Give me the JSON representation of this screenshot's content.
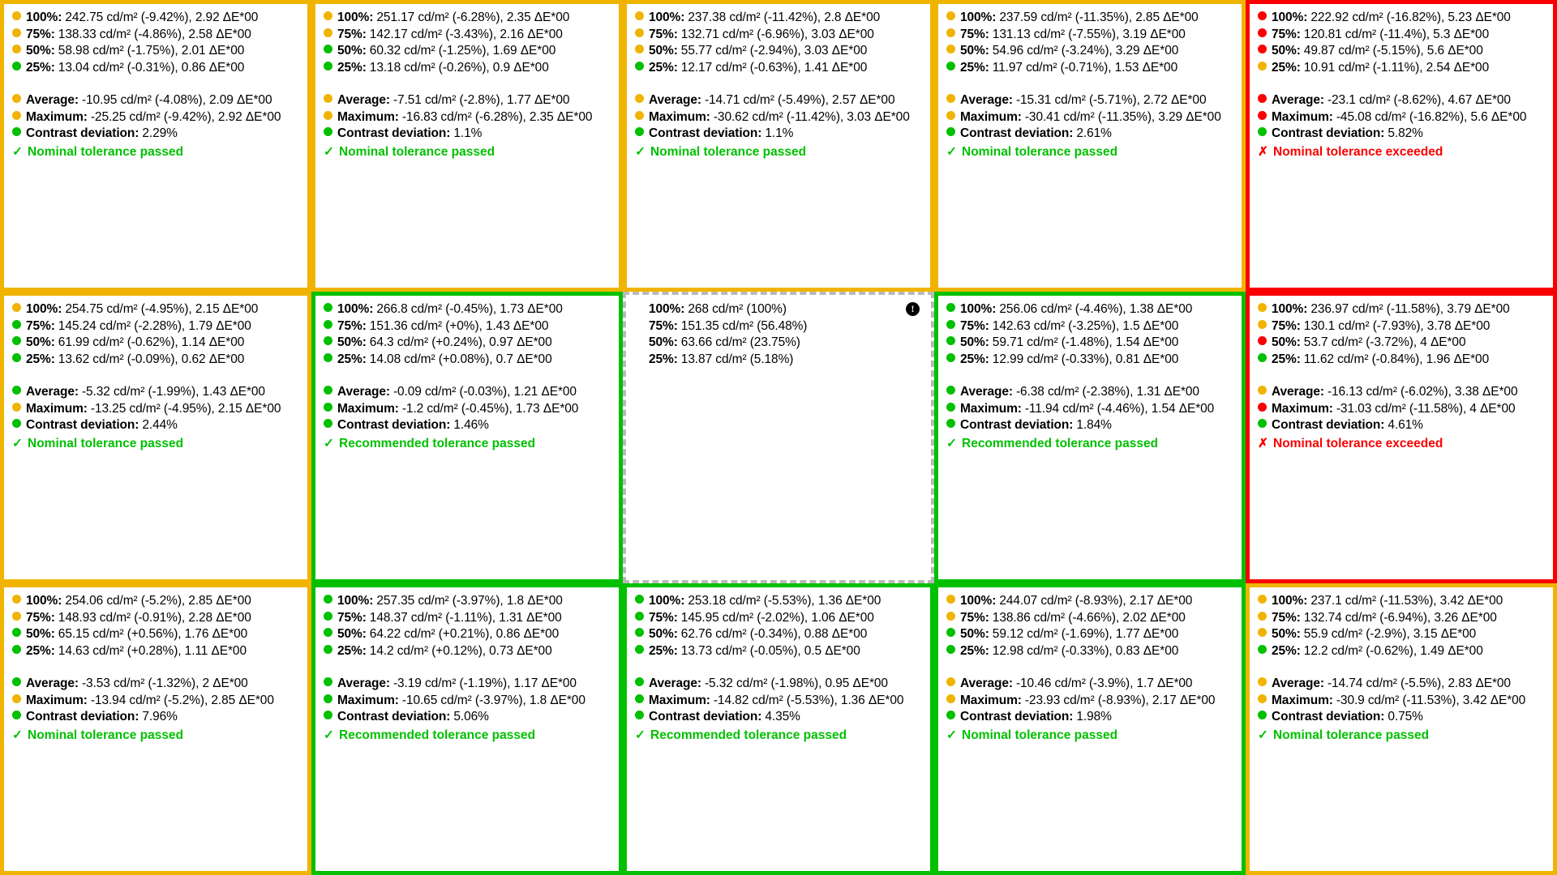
{
  "theme": {
    "amber": "#f0b400",
    "green": "#00c000",
    "red": "#fa0000",
    "reference_border": "#b9b9b9",
    "text": "#000000",
    "background": "#ffffff"
  },
  "icons": {
    "info": "!",
    "pass_mark": "✓",
    "fail_mark": "✗"
  },
  "labels": {
    "l100": "100%:",
    "l75": "75%:",
    "l50": "50%:",
    "l25": "25%:",
    "average": "Average:",
    "maximum": "Maximum:",
    "contrast": "Contrast deviation:"
  },
  "cells": [
    {
      "id": "cell-r1c1",
      "status": "amber",
      "reference": false,
      "rows": [
        {
          "dot": "amber",
          "label": "100%:",
          "value": "242.75 cd/m² (-9.42%), 2.92 ΔE*00"
        },
        {
          "dot": "amber",
          "label": "75%:",
          "value": "138.33 cd/m² (-4.86%), 2.58 ΔE*00"
        },
        {
          "dot": "amber",
          "label": "50%:",
          "value": "58.98 cd/m² (-1.75%), 2.01 ΔE*00"
        },
        {
          "dot": "green",
          "label": "25%:",
          "value": "13.04 cd/m² (-0.31%), 0.86 ΔE*00"
        }
      ],
      "summary": [
        {
          "dot": "amber",
          "label": "Average:",
          "value": "-10.95 cd/m² (-4.08%), 2.09 ΔE*00"
        },
        {
          "dot": "amber",
          "label": "Maximum:",
          "value": "-25.25 cd/m² (-9.42%), 2.92 ΔE*00"
        },
        {
          "dot": "green",
          "label": "Contrast deviation:",
          "value": "2.29%"
        }
      ],
      "verdict": {
        "result": "pass",
        "mark": "✓",
        "text": "Nominal tolerance passed"
      }
    },
    {
      "id": "cell-r1c2",
      "status": "amber",
      "reference": false,
      "rows": [
        {
          "dot": "amber",
          "label": "100%:",
          "value": "251.17 cd/m² (-6.28%), 2.35 ΔE*00"
        },
        {
          "dot": "amber",
          "label": "75%:",
          "value": "142.17 cd/m² (-3.43%), 2.16 ΔE*00"
        },
        {
          "dot": "green",
          "label": "50%:",
          "value": "60.32 cd/m² (-1.25%), 1.69 ΔE*00"
        },
        {
          "dot": "green",
          "label": "25%:",
          "value": "13.18 cd/m² (-0.26%), 0.9 ΔE*00"
        }
      ],
      "summary": [
        {
          "dot": "amber",
          "label": "Average:",
          "value": "-7.51 cd/m² (-2.8%), 1.77 ΔE*00"
        },
        {
          "dot": "amber",
          "label": "Maximum:",
          "value": "-16.83 cd/m² (-6.28%), 2.35 ΔE*00"
        },
        {
          "dot": "green",
          "label": "Contrast deviation:",
          "value": "1.1%"
        }
      ],
      "verdict": {
        "result": "pass",
        "mark": "✓",
        "text": "Nominal tolerance passed"
      }
    },
    {
      "id": "cell-r1c3",
      "status": "amber",
      "reference": false,
      "rows": [
        {
          "dot": "amber",
          "label": "100%:",
          "value": "237.38 cd/m² (-11.42%), 2.8 ΔE*00"
        },
        {
          "dot": "amber",
          "label": "75%:",
          "value": "132.71 cd/m² (-6.96%), 3.03 ΔE*00"
        },
        {
          "dot": "amber",
          "label": "50%:",
          "value": "55.77 cd/m² (-2.94%), 3.03 ΔE*00"
        },
        {
          "dot": "green",
          "label": "25%:",
          "value": "12.17 cd/m² (-0.63%), 1.41 ΔE*00"
        }
      ],
      "summary": [
        {
          "dot": "amber",
          "label": "Average:",
          "value": "-14.71 cd/m² (-5.49%), 2.57 ΔE*00"
        },
        {
          "dot": "amber",
          "label": "Maximum:",
          "value": "-30.62 cd/m² (-11.42%), 3.03 ΔE*00"
        },
        {
          "dot": "green",
          "label": "Contrast deviation:",
          "value": "1.1%"
        }
      ],
      "verdict": {
        "result": "pass",
        "mark": "✓",
        "text": "Nominal tolerance passed"
      }
    },
    {
      "id": "cell-r1c4",
      "status": "amber",
      "reference": false,
      "rows": [
        {
          "dot": "amber",
          "label": "100%:",
          "value": "237.59 cd/m² (-11.35%), 2.85 ΔE*00"
        },
        {
          "dot": "amber",
          "label": "75%:",
          "value": "131.13 cd/m² (-7.55%), 3.19 ΔE*00"
        },
        {
          "dot": "amber",
          "label": "50%:",
          "value": "54.96 cd/m² (-3.24%), 3.29 ΔE*00"
        },
        {
          "dot": "green",
          "label": "25%:",
          "value": "11.97 cd/m² (-0.71%), 1.53 ΔE*00"
        }
      ],
      "summary": [
        {
          "dot": "amber",
          "label": "Average:",
          "value": "-15.31 cd/m² (-5.71%), 2.72 ΔE*00"
        },
        {
          "dot": "amber",
          "label": "Maximum:",
          "value": "-30.41 cd/m² (-11.35%), 3.29 ΔE*00"
        },
        {
          "dot": "green",
          "label": "Contrast deviation:",
          "value": "2.61%"
        }
      ],
      "verdict": {
        "result": "pass",
        "mark": "✓",
        "text": "Nominal tolerance passed"
      }
    },
    {
      "id": "cell-r1c5",
      "status": "red",
      "reference": false,
      "rows": [
        {
          "dot": "red",
          "label": "100%:",
          "value": "222.92 cd/m² (-16.82%), 5.23 ΔE*00"
        },
        {
          "dot": "red",
          "label": "75%:",
          "value": "120.81 cd/m² (-11.4%), 5.3 ΔE*00"
        },
        {
          "dot": "red",
          "label": "50%:",
          "value": "49.87 cd/m² (-5.15%), 5.6 ΔE*00"
        },
        {
          "dot": "amber",
          "label": "25%:",
          "value": "10.91 cd/m² (-1.11%), 2.54 ΔE*00"
        }
      ],
      "summary": [
        {
          "dot": "red",
          "label": "Average:",
          "value": "-23.1 cd/m² (-8.62%), 4.67 ΔE*00"
        },
        {
          "dot": "red",
          "label": "Maximum:",
          "value": "-45.08 cd/m² (-16.82%), 5.6 ΔE*00"
        },
        {
          "dot": "green",
          "label": "Contrast deviation:",
          "value": "5.82%"
        }
      ],
      "verdict": {
        "result": "fail",
        "mark": "✗",
        "text": "Nominal tolerance exceeded"
      }
    },
    {
      "id": "cell-r2c1",
      "status": "amber",
      "reference": false,
      "rows": [
        {
          "dot": "amber",
          "label": "100%:",
          "value": "254.75 cd/m² (-4.95%), 2.15 ΔE*00"
        },
        {
          "dot": "green",
          "label": "75%:",
          "value": "145.24 cd/m² (-2.28%), 1.79 ΔE*00"
        },
        {
          "dot": "green",
          "label": "50%:",
          "value": "61.99 cd/m² (-0.62%), 1.14 ΔE*00"
        },
        {
          "dot": "green",
          "label": "25%:",
          "value": "13.62 cd/m² (-0.09%), 0.62 ΔE*00"
        }
      ],
      "summary": [
        {
          "dot": "green",
          "label": "Average:",
          "value": "-5.32 cd/m² (-1.99%), 1.43 ΔE*00"
        },
        {
          "dot": "amber",
          "label": "Maximum:",
          "value": "-13.25 cd/m² (-4.95%), 2.15 ΔE*00"
        },
        {
          "dot": "green",
          "label": "Contrast deviation:",
          "value": "2.44%"
        }
      ],
      "verdict": {
        "result": "pass",
        "mark": "✓",
        "text": "Nominal tolerance passed"
      }
    },
    {
      "id": "cell-r2c2",
      "status": "green",
      "reference": false,
      "rows": [
        {
          "dot": "green",
          "label": "100%:",
          "value": "266.8 cd/m² (-0.45%), 1.73 ΔE*00"
        },
        {
          "dot": "green",
          "label": "75%:",
          "value": "151.36 cd/m² (+0%), 1.43 ΔE*00"
        },
        {
          "dot": "green",
          "label": "50%:",
          "value": "64.3 cd/m² (+0.24%), 0.97 ΔE*00"
        },
        {
          "dot": "green",
          "label": "25%:",
          "value": "14.08 cd/m² (+0.08%), 0.7 ΔE*00"
        }
      ],
      "summary": [
        {
          "dot": "green",
          "label": "Average:",
          "value": "-0.09 cd/m² (-0.03%), 1.21 ΔE*00"
        },
        {
          "dot": "green",
          "label": "Maximum:",
          "value": "-1.2 cd/m² (-0.45%), 1.73 ΔE*00"
        },
        {
          "dot": "green",
          "label": "Contrast deviation:",
          "value": "1.46%"
        }
      ],
      "verdict": {
        "result": "pass",
        "mark": "✓",
        "text": "Recommended tolerance passed"
      }
    },
    {
      "id": "cell-r2c3",
      "status": "ref",
      "reference": true,
      "info_icon": "!",
      "rows": [
        {
          "dot": "none",
          "label": "100%:",
          "value": "268 cd/m² (100%)"
        },
        {
          "dot": "none",
          "label": "75%:",
          "value": "151.35 cd/m² (56.48%)"
        },
        {
          "dot": "none",
          "label": "50%:",
          "value": "63.66 cd/m² (23.75%)"
        },
        {
          "dot": "none",
          "label": "25%:",
          "value": "13.87 cd/m² (5.18%)"
        }
      ],
      "summary": [],
      "verdict": null
    },
    {
      "id": "cell-r2c4",
      "status": "green",
      "reference": false,
      "rows": [
        {
          "dot": "green",
          "label": "100%:",
          "value": "256.06 cd/m² (-4.46%), 1.38 ΔE*00"
        },
        {
          "dot": "green",
          "label": "75%:",
          "value": "142.63 cd/m² (-3.25%), 1.5 ΔE*00"
        },
        {
          "dot": "green",
          "label": "50%:",
          "value": "59.71 cd/m² (-1.48%), 1.54 ΔE*00"
        },
        {
          "dot": "green",
          "label": "25%:",
          "value": "12.99 cd/m² (-0.33%), 0.81 ΔE*00"
        }
      ],
      "summary": [
        {
          "dot": "green",
          "label": "Average:",
          "value": "-6.38 cd/m² (-2.38%), 1.31 ΔE*00"
        },
        {
          "dot": "green",
          "label": "Maximum:",
          "value": "-11.94 cd/m² (-4.46%), 1.54 ΔE*00"
        },
        {
          "dot": "green",
          "label": "Contrast deviation:",
          "value": "1.84%"
        }
      ],
      "verdict": {
        "result": "pass",
        "mark": "✓",
        "text": "Recommended tolerance passed"
      }
    },
    {
      "id": "cell-r2c5",
      "status": "red",
      "reference": false,
      "rows": [
        {
          "dot": "amber",
          "label": "100%:",
          "value": "236.97 cd/m² (-11.58%), 3.79 ΔE*00"
        },
        {
          "dot": "amber",
          "label": "75%:",
          "value": "130.1 cd/m² (-7.93%), 3.78 ΔE*00"
        },
        {
          "dot": "red",
          "label": "50%:",
          "value": "53.7 cd/m² (-3.72%), 4 ΔE*00"
        },
        {
          "dot": "green",
          "label": "25%:",
          "value": "11.62 cd/m² (-0.84%), 1.96 ΔE*00"
        }
      ],
      "summary": [
        {
          "dot": "amber",
          "label": "Average:",
          "value": "-16.13 cd/m² (-6.02%), 3.38 ΔE*00"
        },
        {
          "dot": "red",
          "label": "Maximum:",
          "value": "-31.03 cd/m² (-11.58%), 4 ΔE*00"
        },
        {
          "dot": "green",
          "label": "Contrast deviation:",
          "value": "4.61%"
        }
      ],
      "verdict": {
        "result": "fail",
        "mark": "✗",
        "text": "Nominal tolerance exceeded"
      }
    },
    {
      "id": "cell-r3c1",
      "status": "amber",
      "reference": false,
      "rows": [
        {
          "dot": "amber",
          "label": "100%:",
          "value": "254.06 cd/m² (-5.2%), 2.85 ΔE*00"
        },
        {
          "dot": "amber",
          "label": "75%:",
          "value": "148.93 cd/m² (-0.91%), 2.28 ΔE*00"
        },
        {
          "dot": "green",
          "label": "50%:",
          "value": "65.15 cd/m² (+0.56%), 1.76 ΔE*00"
        },
        {
          "dot": "green",
          "label": "25%:",
          "value": "14.63 cd/m² (+0.28%), 1.11 ΔE*00"
        }
      ],
      "summary": [
        {
          "dot": "green",
          "label": "Average:",
          "value": "-3.53 cd/m² (-1.32%), 2 ΔE*00"
        },
        {
          "dot": "amber",
          "label": "Maximum:",
          "value": "-13.94 cd/m² (-5.2%), 2.85 ΔE*00"
        },
        {
          "dot": "green",
          "label": "Contrast deviation:",
          "value": "7.96%"
        }
      ],
      "verdict": {
        "result": "pass",
        "mark": "✓",
        "text": "Nominal tolerance passed"
      }
    },
    {
      "id": "cell-r3c2",
      "status": "green",
      "reference": false,
      "rows": [
        {
          "dot": "green",
          "label": "100%:",
          "value": "257.35 cd/m² (-3.97%), 1.8 ΔE*00"
        },
        {
          "dot": "green",
          "label": "75%:",
          "value": "148.37 cd/m² (-1.11%), 1.31 ΔE*00"
        },
        {
          "dot": "green",
          "label": "50%:",
          "value": "64.22 cd/m² (+0.21%), 0.86 ΔE*00"
        },
        {
          "dot": "green",
          "label": "25%:",
          "value": "14.2 cd/m² (+0.12%), 0.73 ΔE*00"
        }
      ],
      "summary": [
        {
          "dot": "green",
          "label": "Average:",
          "value": "-3.19 cd/m² (-1.19%), 1.17 ΔE*00"
        },
        {
          "dot": "green",
          "label": "Maximum:",
          "value": "-10.65 cd/m² (-3.97%), 1.8 ΔE*00"
        },
        {
          "dot": "green",
          "label": "Contrast deviation:",
          "value": "5.06%"
        }
      ],
      "verdict": {
        "result": "pass",
        "mark": "✓",
        "text": "Recommended tolerance passed"
      }
    },
    {
      "id": "cell-r3c3",
      "status": "green",
      "reference": false,
      "rows": [
        {
          "dot": "green",
          "label": "100%:",
          "value": "253.18 cd/m² (-5.53%), 1.36 ΔE*00"
        },
        {
          "dot": "green",
          "label": "75%:",
          "value": "145.95 cd/m² (-2.02%), 1.06 ΔE*00"
        },
        {
          "dot": "green",
          "label": "50%:",
          "value": "62.76 cd/m² (-0.34%), 0.88 ΔE*00"
        },
        {
          "dot": "green",
          "label": "25%:",
          "value": "13.73 cd/m² (-0.05%), 0.5 ΔE*00"
        }
      ],
      "summary": [
        {
          "dot": "green",
          "label": "Average:",
          "value": "-5.32 cd/m² (-1.98%), 0.95 ΔE*00"
        },
        {
          "dot": "green",
          "label": "Maximum:",
          "value": "-14.82 cd/m² (-5.53%), 1.36 ΔE*00"
        },
        {
          "dot": "green",
          "label": "Contrast deviation:",
          "value": "4.35%"
        }
      ],
      "verdict": {
        "result": "pass",
        "mark": "✓",
        "text": "Recommended tolerance passed"
      }
    },
    {
      "id": "cell-r3c4",
      "status": "green",
      "reference": false,
      "rows": [
        {
          "dot": "amber",
          "label": "100%:",
          "value": "244.07 cd/m² (-8.93%), 2.17 ΔE*00"
        },
        {
          "dot": "amber",
          "label": "75%:",
          "value": "138.86 cd/m² (-4.66%), 2.02 ΔE*00"
        },
        {
          "dot": "green",
          "label": "50%:",
          "value": "59.12 cd/m² (-1.69%), 1.77 ΔE*00"
        },
        {
          "dot": "green",
          "label": "25%:",
          "value": "12.98 cd/m² (-0.33%), 0.83 ΔE*00"
        }
      ],
      "summary": [
        {
          "dot": "amber",
          "label": "Average:",
          "value": "-10.46 cd/m² (-3.9%), 1.7 ΔE*00"
        },
        {
          "dot": "amber",
          "label": "Maximum:",
          "value": "-23.93 cd/m² (-8.93%), 2.17 ΔE*00"
        },
        {
          "dot": "green",
          "label": "Contrast deviation:",
          "value": "1.98%"
        }
      ],
      "verdict": {
        "result": "pass",
        "mark": "✓",
        "text": "Nominal tolerance passed"
      }
    },
    {
      "id": "cell-r3c5",
      "status": "amber",
      "reference": false,
      "rows": [
        {
          "dot": "amber",
          "label": "100%:",
          "value": "237.1 cd/m² (-11.53%), 3.42 ΔE*00"
        },
        {
          "dot": "amber",
          "label": "75%:",
          "value": "132.74 cd/m² (-6.94%), 3.26 ΔE*00"
        },
        {
          "dot": "amber",
          "label": "50%:",
          "value": "55.9 cd/m² (-2.9%), 3.15 ΔE*00"
        },
        {
          "dot": "green",
          "label": "25%:",
          "value": "12.2 cd/m² (-0.62%), 1.49 ΔE*00"
        }
      ],
      "summary": [
        {
          "dot": "amber",
          "label": "Average:",
          "value": "-14.74 cd/m² (-5.5%), 2.83 ΔE*00"
        },
        {
          "dot": "amber",
          "label": "Maximum:",
          "value": "-30.9 cd/m² (-11.53%), 3.42 ΔE*00"
        },
        {
          "dot": "green",
          "label": "Contrast deviation:",
          "value": "0.75%"
        }
      ],
      "verdict": {
        "result": "pass",
        "mark": "✓",
        "text": "Nominal tolerance passed"
      }
    }
  ]
}
